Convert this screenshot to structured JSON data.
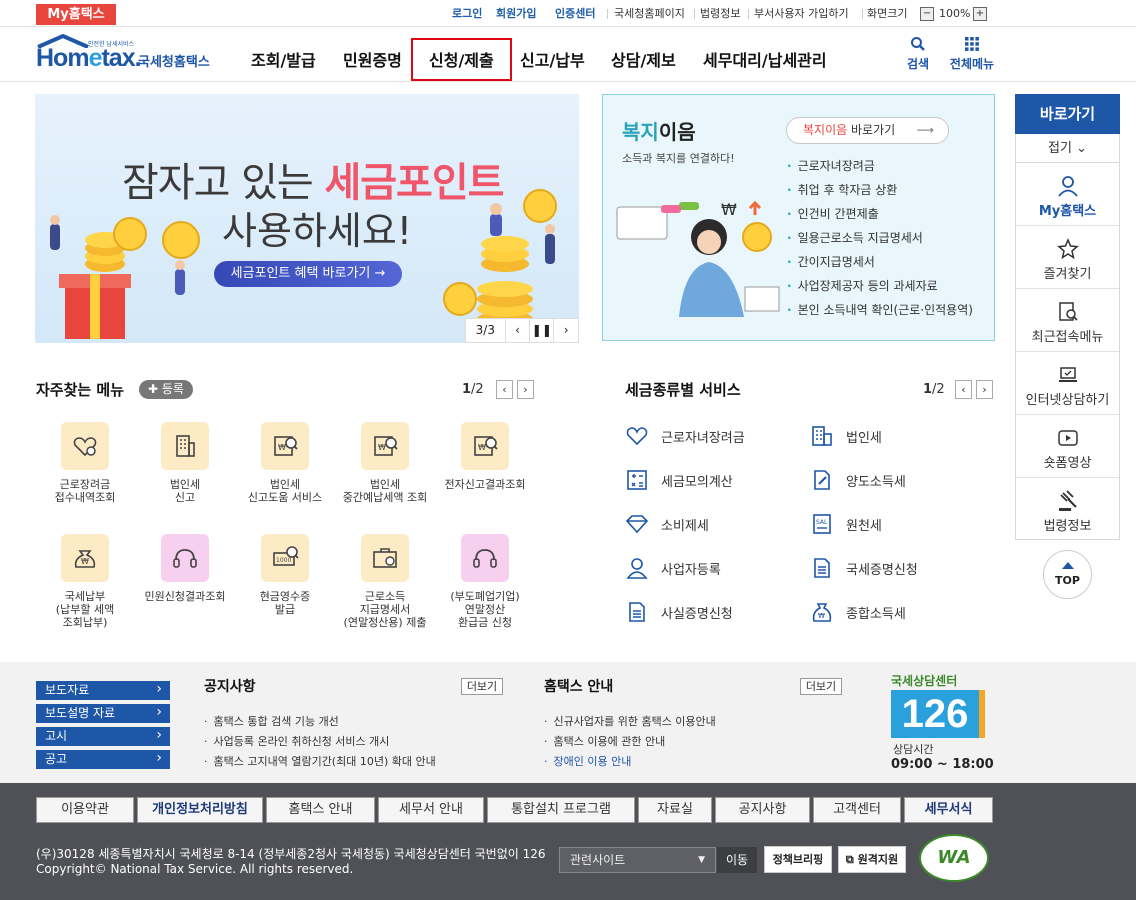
{
  "topbar": {
    "myhome": "My홈택스",
    "login": "로그인",
    "join": "회원가입",
    "cert": "인증센터",
    "nts_page": "국세청홈페이지",
    "law": "법령정보",
    "dept_join": "부서사용자 가입하기",
    "screen_size": "화면크기",
    "zoom": "100%"
  },
  "header": {
    "logo_text": "Hometax",
    "logo_sub": "국세청홈택스",
    "logo_tiny": "안전한 납세서비스",
    "gnb": [
      "조회/발급",
      "민원증명",
      "신청/제출",
      "신고/납부",
      "상담/제보",
      "세무대리/납세관리"
    ],
    "search": "검색",
    "allmenu": "전체메뉴"
  },
  "banner": {
    "line1_pre": "잠자고 있는 ",
    "line1_hl": "세금포인트",
    "line2": "사용하세요!",
    "button": "세금포인트 혜택 바로가기 →",
    "page": "3/3"
  },
  "welfare": {
    "title_a": "복지",
    "title_b": "이음",
    "sub": "소득과 복지를 연결하다!",
    "link_a": "복지이음",
    "link_b": " 바로가기",
    "items": [
      "근로자녀장려금",
      "취업 후 학자금 상환",
      "인건비 간편제출",
      "일용근로소득 지급명세서",
      "간이지급명세서",
      "사업장제공자 등의 과세자료",
      "본인 소득내역 확인(근로·인적용역)"
    ]
  },
  "side": {
    "title": "바로가기",
    "fold": "접기",
    "items": [
      "My홈택스",
      "즐겨찾기",
      "최근접속메뉴",
      "인터넷상담하기",
      "숏폼영상",
      "법령정보"
    ],
    "top": "TOP"
  },
  "freq": {
    "title": "자주찾는 메뉴",
    "register": "등록",
    "page_cur": "1",
    "page_total": "/2",
    "items": [
      [
        "근로장려금",
        "접수내역조회"
      ],
      [
        "법인세",
        "신고"
      ],
      [
        "법인세",
        "신고도움 서비스"
      ],
      [
        "법인세",
        "중간예납세액 조회"
      ],
      [
        "전자신고결과조회"
      ],
      [
        "국세납부",
        "(납부할 세액",
        "조회납부)"
      ],
      [
        "민원신청결과조회"
      ],
      [
        "현금영수증",
        "발급"
      ],
      [
        "근로소득",
        "지급명세서",
        "(연말정산용) 제출"
      ],
      [
        "(부도폐업기업)",
        "연말정산",
        "환급금 신청"
      ]
    ]
  },
  "tax": {
    "title": "세금종류별 서비스",
    "page_cur": "1",
    "page_total": "/2",
    "items": [
      "근로자녀장려금",
      "법인세",
      "세금모의계산",
      "양도소득세",
      "소비제세",
      "원천세",
      "사업자등록",
      "국세증명신청",
      "사실증명신청",
      "종합소득세"
    ]
  },
  "notice": {
    "buttons": [
      "보도자료",
      "보도설명 자료",
      "고시",
      "공고"
    ],
    "notice_title": "공지사항",
    "notice_items": [
      "홈택스 통합 검색 기능 개선",
      "사업등록 온라인 취하신청 서비스 개시",
      "홈택스 고지내역 열람기간(최대 10년) 확대 안내"
    ],
    "guide_title": "홈택스 안내",
    "guide_items": [
      "신규사업자를 위한 홈택스 이용안내",
      "홈택스 이용에 관한 안내",
      "장애인 이용 안내"
    ],
    "more": "더보기",
    "center_label": "국세상담센터",
    "center_number": "126",
    "hours_label": "상담시간",
    "hours": "09:00 ~ 18:00"
  },
  "footer": {
    "links": [
      "이용약관",
      "개인정보처리방침",
      "홈택스 안내",
      "세무서 안내",
      "통합설치 프로그램",
      "자료실",
      "공지사항",
      "고객센터",
      "세무서식"
    ],
    "address": "(우)30128 세종특별자치시 국세청로 8-14 (정부세종2청사 국세청동) 국세청상담센터 국번없이 126",
    "copyright": "Copyright© National Tax Service. All rights reserved.",
    "related": "관련사이트",
    "move": "이동",
    "badge1": "정책브리핑",
    "badge2": "원격지원",
    "wa": "WA"
  },
  "colors": {
    "brand_blue": "#1e56a8",
    "accent_red": "#e8453c",
    "highlight": "#e30613",
    "teal": "#2aa3b8"
  }
}
